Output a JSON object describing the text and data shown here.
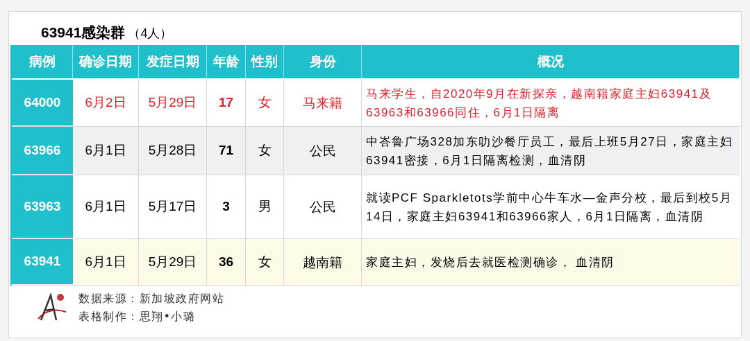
{
  "title": {
    "name": "63941感染群",
    "count": "（4人）"
  },
  "table": {
    "columns": [
      "病例",
      "确诊日期",
      "发症日期",
      "年龄",
      "性别",
      "身份",
      "概况"
    ],
    "rows": [
      {
        "case": "64000",
        "confirmed": "6月2日",
        "onset": "5月29日",
        "age": "17",
        "sex": "女",
        "status": "马来籍",
        "summary": "马来学生，自2020年9月在新探亲，越南籍家庭主妇63941及63963和63966同住，6月1日隔离",
        "highlighted": true,
        "color": "#ffffff"
      },
      {
        "case": "63966",
        "confirmed": "6月1日",
        "onset": "5月28日",
        "age": "71",
        "sex": "女",
        "status": "公民",
        "summary": "中峇鲁广场328加东叻沙餐厅员工，最后上班5月27日，家庭主妇63941密接，6月1日隔离检测，血清阴",
        "highlighted": false,
        "color": "#f0f0f2"
      },
      {
        "case": "63963",
        "confirmed": "6月1日",
        "onset": "5月17日",
        "age": "3",
        "sex": "男",
        "status": "公民",
        "summary": "就读PCF Sparkletots学前中心牛车水—金声分校，最后到校5月14日，家庭主妇63941和63966家人，6月1日隔离，血清阴",
        "highlighted": false,
        "color": "#ffffff"
      },
      {
        "case": "63941",
        "confirmed": "6月1日",
        "onset": "5月29日",
        "age": "36",
        "sex": "女",
        "status": "越南籍",
        "summary": "家庭主妇，发烧后去就医检测确诊， 血清阴",
        "highlighted": false,
        "color": "#fdfbe8"
      }
    ]
  },
  "footer": {
    "source": "数据来源：新加坡政府网站",
    "author": "表格制作：思翔•小璐"
  }
}
